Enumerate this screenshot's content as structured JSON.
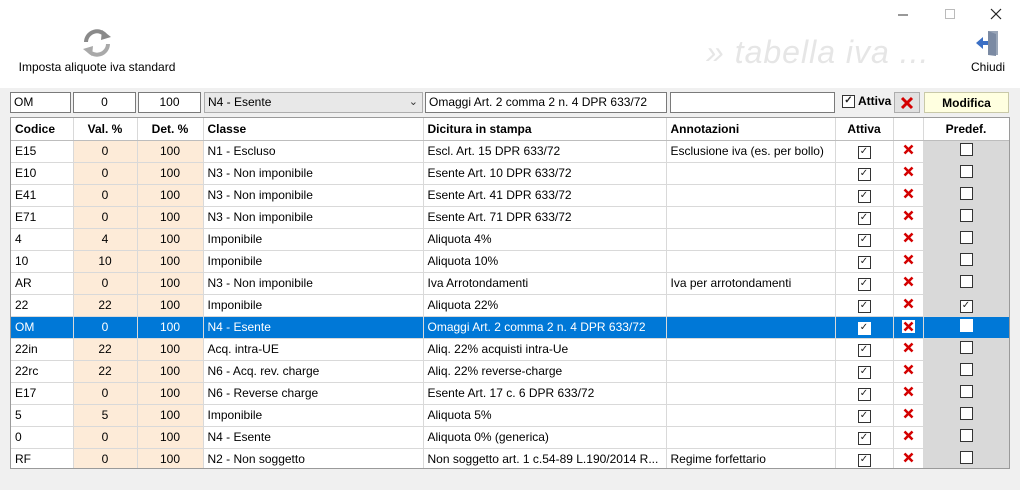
{
  "toolbar": {
    "std_label": "Imposta aliquote iva standard",
    "close_label": "Chiudi",
    "watermark": "» tabella iva ..."
  },
  "edit": {
    "codice": "OM",
    "val": "0",
    "det": "100",
    "classe": "N4 - Esente",
    "dicitura": "Omaggi Art. 2 comma 2 n. 4 DPR 633/72",
    "annotazioni": "",
    "attiva_label": "Attiva",
    "modifica_label": "Modifica"
  },
  "columns": [
    "Codice",
    "Val. %",
    "Det. %",
    "Classe",
    "Dicitura in stampa",
    "Annotazioni",
    "Attiva",
    "",
    "Predef."
  ],
  "rows": [
    {
      "codice": "E15",
      "val": "0",
      "det": "100",
      "classe": "N1 - Escluso",
      "dicitura": "Escl. Art. 15 DPR 633/72",
      "annotazioni": "Esclusione iva (es. per bollo)",
      "attiva": true,
      "predef": false
    },
    {
      "codice": "E10",
      "val": "0",
      "det": "100",
      "classe": "N3 - Non imponibile",
      "dicitura": "Esente Art. 10 DPR 633/72",
      "annotazioni": "",
      "attiva": true,
      "predef": false
    },
    {
      "codice": "E41",
      "val": "0",
      "det": "100",
      "classe": "N3 - Non imponibile",
      "dicitura": "Esente Art. 41 DPR 633/72",
      "annotazioni": "",
      "attiva": true,
      "predef": false
    },
    {
      "codice": "E71",
      "val": "0",
      "det": "100",
      "classe": "N3 - Non imponibile",
      "dicitura": "Esente Art. 71 DPR 633/72",
      "annotazioni": "",
      "attiva": true,
      "predef": false
    },
    {
      "codice": "4",
      "val": "4",
      "det": "100",
      "classe": "Imponibile",
      "dicitura": "Aliquota 4%",
      "annotazioni": "",
      "attiva": true,
      "predef": false
    },
    {
      "codice": "10",
      "val": "10",
      "det": "100",
      "classe": "Imponibile",
      "dicitura": "Aliquota 10%",
      "annotazioni": "",
      "attiva": true,
      "predef": false
    },
    {
      "codice": "AR",
      "val": "0",
      "det": "100",
      "classe": "N3 - Non imponibile",
      "dicitura": "Iva Arrotondamenti",
      "annotazioni": "Iva per arrotondamenti",
      "attiva": true,
      "predef": false
    },
    {
      "codice": "22",
      "val": "22",
      "det": "100",
      "classe": "Imponibile",
      "dicitura": "Aliquota 22%",
      "annotazioni": "",
      "attiva": true,
      "predef": true
    },
    {
      "codice": "OM",
      "val": "0",
      "det": "100",
      "classe": "N4 - Esente",
      "dicitura": "Omaggi Art. 2 comma 2 n. 4 DPR 633/72",
      "annotazioni": "",
      "attiva": true,
      "predef": false,
      "selected": true
    },
    {
      "codice": "22in",
      "val": "22",
      "det": "100",
      "classe": "Acq. intra-UE",
      "dicitura": "Aliq. 22% acquisti intra-Ue",
      "annotazioni": "",
      "attiva": true,
      "predef": false
    },
    {
      "codice": "22rc",
      "val": "22",
      "det": "100",
      "classe": "N6 - Acq. rev. charge",
      "dicitura": "Aliq. 22% reverse-charge",
      "annotazioni": "",
      "attiva": true,
      "predef": false
    },
    {
      "codice": "E17",
      "val": "0",
      "det": "100",
      "classe": "N6 - Reverse charge",
      "dicitura": "Esente Art. 17 c. 6 DPR 633/72",
      "annotazioni": "",
      "attiva": true,
      "predef": false
    },
    {
      "codice": "5",
      "val": "5",
      "det": "100",
      "classe": "Imponibile",
      "dicitura": "Aliquota 5%",
      "annotazioni": "",
      "attiva": true,
      "predef": false
    },
    {
      "codice": "0",
      "val": "0",
      "det": "100",
      "classe": "N4 - Esente",
      "dicitura": "Aliquota 0% (generica)",
      "annotazioni": "",
      "attiva": true,
      "predef": false
    },
    {
      "codice": "RF",
      "val": "0",
      "det": "100",
      "classe": "N2 - Non soggetto",
      "dicitura": "Non soggetto art. 1 c.54-89 L.190/2014 R...",
      "annotazioni": "Regime forfettario",
      "attiva": true,
      "predef": false
    }
  ],
  "icons": {
    "refresh": "refresh-icon",
    "exit": "exit-door-icon",
    "delete": "delete-x-icon",
    "check": "checkmark-icon"
  },
  "colors": {
    "selection": "#0078d7",
    "numeric_cell": "#fdebd8",
    "predef_cell": "#d9d9d9",
    "modifica_bg": "#ffffe0",
    "delete_x": "#d40000"
  }
}
